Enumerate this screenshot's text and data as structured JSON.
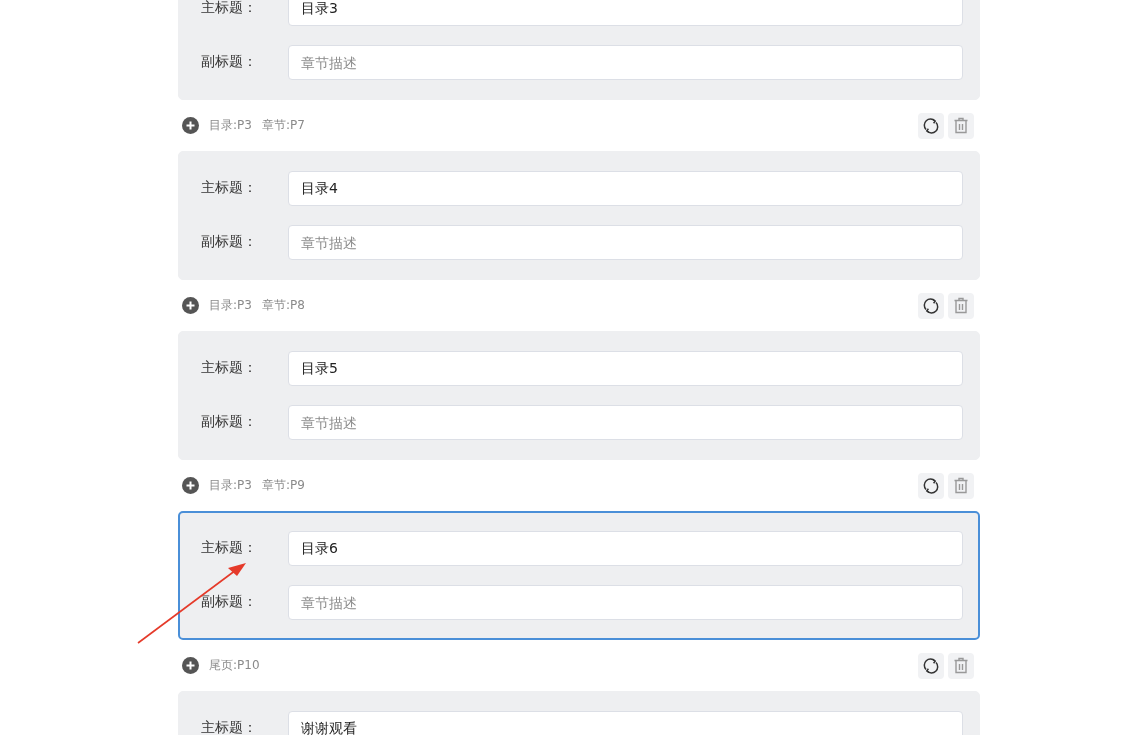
{
  "sections": [
    {
      "card": {
        "selected": false,
        "fields": [
          {
            "label": "主标题：",
            "value": "目录3"
          },
          {
            "label": "副标题：",
            "placeholder": "章节描述"
          }
        ]
      }
    },
    {
      "meta": [
        "目录:P3",
        "章节:P7"
      ],
      "card": {
        "selected": false,
        "fields": [
          {
            "label": "主标题：",
            "value": "目录4"
          },
          {
            "label": "副标题：",
            "placeholder": "章节描述"
          }
        ]
      }
    },
    {
      "meta": [
        "目录:P3",
        "章节:P8"
      ],
      "card": {
        "selected": false,
        "fields": [
          {
            "label": "主标题：",
            "value": "目录5"
          },
          {
            "label": "副标题：",
            "placeholder": "章节描述"
          }
        ]
      }
    },
    {
      "meta": [
        "目录:P3",
        "章节:P9"
      ],
      "card": {
        "selected": true,
        "fields": [
          {
            "label": "主标题：",
            "value": "目录6"
          },
          {
            "label": "副标题：",
            "placeholder": "章节描述"
          }
        ]
      }
    },
    {
      "meta": [
        "尾页:P10"
      ],
      "card": {
        "selected": false,
        "fields": [
          {
            "label": "主标题：",
            "value": "谢谢观看"
          }
        ]
      }
    }
  ],
  "annotations": [
    {
      "kind": "arrow"
    }
  ]
}
